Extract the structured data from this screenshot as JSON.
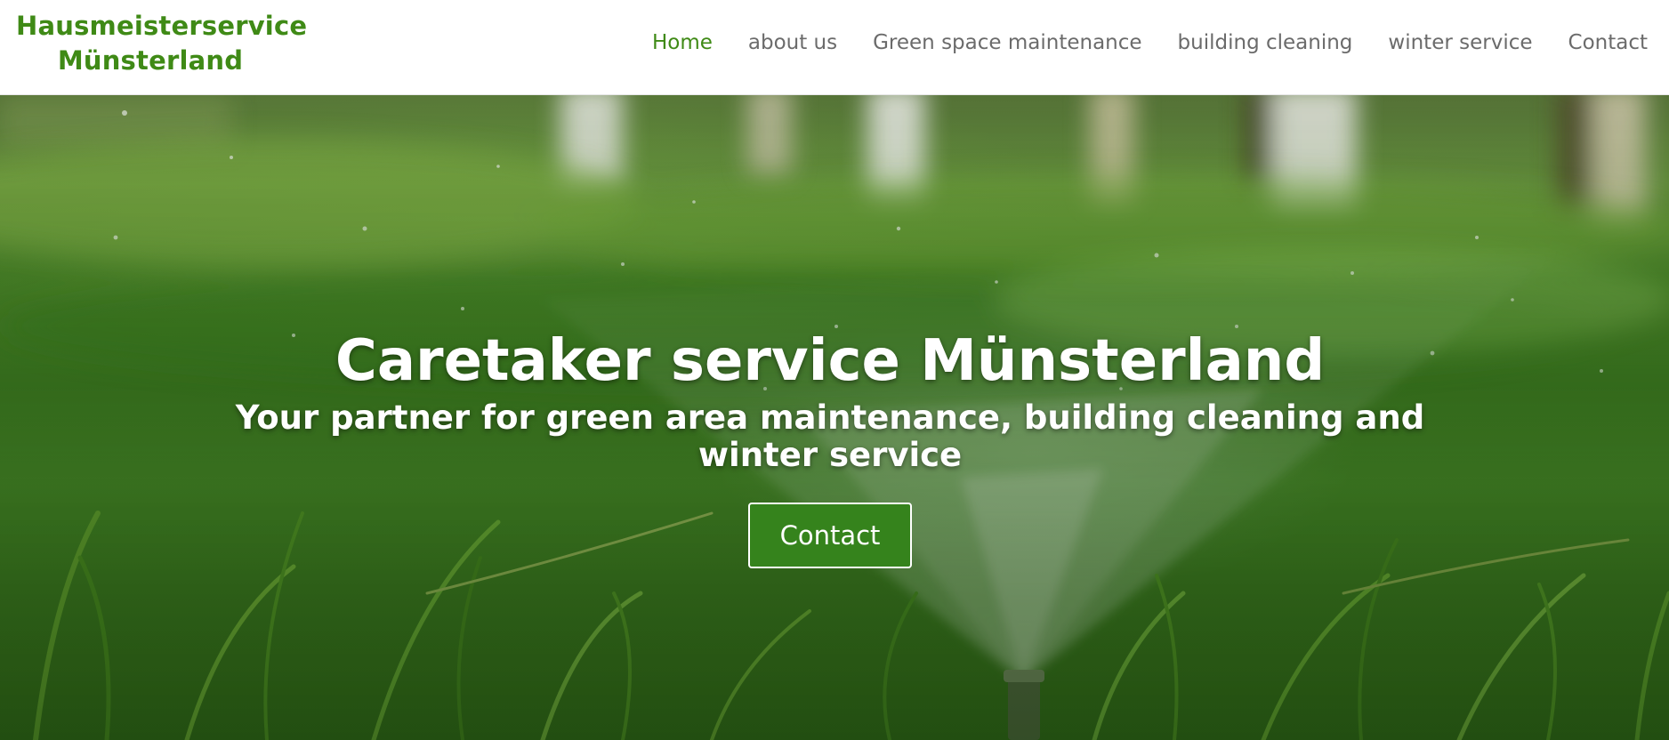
{
  "header": {
    "logo_line1": "Hausmeisterservice",
    "logo_line2": "Münsterland"
  },
  "nav": {
    "items": [
      {
        "label": "Home",
        "active": true
      },
      {
        "label": "about us",
        "active": false
      },
      {
        "label": "Green space maintenance",
        "active": false
      },
      {
        "label": "building cleaning",
        "active": false
      },
      {
        "label": "winter service",
        "active": false
      },
      {
        "label": "Contact",
        "active": false
      }
    ]
  },
  "hero": {
    "title": "Caretaker service Münsterland",
    "subtitle": "Your partner for green area maintenance, building cleaning and winter service",
    "button_label": "Contact",
    "background_icon": "lawn-sprinkler-photo"
  },
  "colors": {
    "brand_green": "#3f8a16",
    "nav_text": "#6b6b6b",
    "button_bg": "#35831c",
    "hero_text": "#ffffff"
  }
}
